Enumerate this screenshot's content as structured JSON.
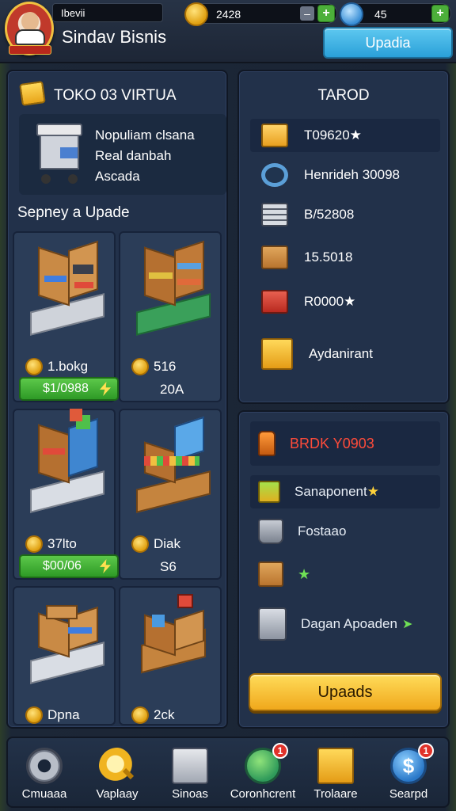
{
  "header": {
    "player_name": "Ibevii",
    "business_name": "Sindav Bisnis",
    "coins": "2428",
    "gems": "45",
    "upgrade_label": "Upadia"
  },
  "shop": {
    "title": "TOKO 03 VIRTUA",
    "info_lines": [
      "Nopuliam clsana",
      "Real danbah",
      "Ascada"
    ],
    "section_label": "Sepney a Upade",
    "items": [
      {
        "price": "1.bokg",
        "buy_label": "$1/0988"
      },
      {
        "price": "516",
        "sub": "20A"
      },
      {
        "price": "37lto",
        "buy_label": "$00/06"
      },
      {
        "price": "Diak",
        "sub": "S6"
      },
      {
        "price": "Dpna"
      },
      {
        "price": "2ck"
      }
    ]
  },
  "side_panel": {
    "title": "TAROD",
    "rows": [
      {
        "text": "T09620",
        "icon": "box-icon",
        "star": true
      },
      {
        "text": "Henrideh 30098",
        "icon": "ring-icon"
      },
      {
        "text": "B/52808",
        "icon": "stack-icon"
      },
      {
        "text": "15.5018",
        "icon": "crate-icon",
        "color": "green"
      },
      {
        "text": "R0000",
        "icon": "red-box-icon",
        "star": true
      },
      {
        "text": "Aydanirant",
        "icon": "gold-box-icon"
      }
    ]
  },
  "offer_panel": {
    "title": "BRDK Y0903",
    "rows": [
      {
        "text": "Sanaponent",
        "icon": "green-box-icon",
        "star": true
      },
      {
        "text": "Fostaao",
        "icon": "pot-icon"
      },
      {
        "text": "",
        "icon": "crate-icon",
        "green_star": true
      },
      {
        "text": "Dagan Apoaden",
        "icon": "bin-icon",
        "arrow": true
      }
    ],
    "button_label": "Upaads"
  },
  "bottom_nav": [
    {
      "label": "Cmuaaa",
      "icon": "gear-icon",
      "badge": ""
    },
    {
      "label": "Vaplaay",
      "icon": "search-icon",
      "badge": ""
    },
    {
      "label": "Sinoas",
      "icon": "store-icon",
      "badge": ""
    },
    {
      "label": "Coronhcrent",
      "icon": "globe-icon",
      "badge": "1"
    },
    {
      "label": "Trolaare",
      "icon": "gift-icon",
      "badge": ""
    },
    {
      "label": "Searpd",
      "icon": "shield-icon",
      "badge": "1"
    }
  ],
  "colors": {
    "panel": "#22314a",
    "accent_blue": "#2aa0d8",
    "accent_green": "#4caf3a",
    "accent_gold": "#f0a81c",
    "alert_red": "#e0322a"
  }
}
